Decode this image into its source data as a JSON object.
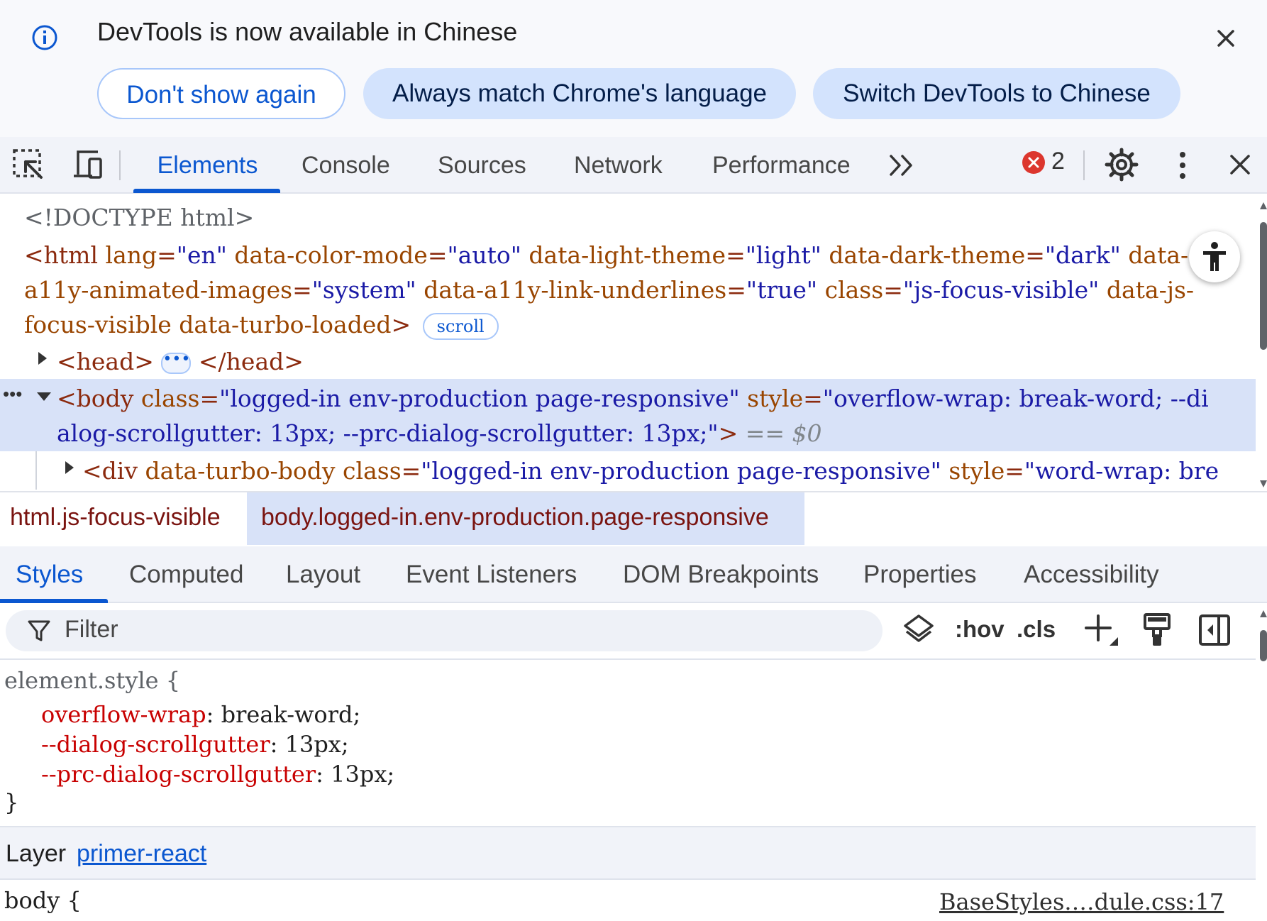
{
  "infobar": {
    "message": "DevTools is now available in Chinese",
    "buttons": [
      "Don't show again",
      "Always match Chrome's language",
      "Switch DevTools to Chinese"
    ]
  },
  "toolbar": {
    "tabs": [
      "Elements",
      "Console",
      "Sources",
      "Network",
      "Performance"
    ],
    "active_tab": "Elements",
    "error_count": "2"
  },
  "tree": {
    "doctype": "<!DOCTYPE html>",
    "html_line1": {
      "open": "<html ",
      "a1": "lang",
      "v1": "\"en\"",
      "a2": "data-color-mode",
      "v2": "\"auto\"",
      "a3": "data-light-theme",
      "v3": "\"light\"",
      "a4": "data-dark-theme",
      "v4": "\"dark\"",
      "a5": "data-"
    },
    "html_line2": {
      "a1": "a11y-animated-images",
      "v1": "\"system\"",
      "a2": "data-a11y-link-underlines",
      "v2": "\"true\"",
      "a3": "class",
      "v3": "\"js-focus-visible\"",
      "a4": "data-js-"
    },
    "html_line3": {
      "a1": "focus-visible data-turbo-loaded",
      "close": ">",
      "badge": "scroll"
    },
    "head": {
      "open": "<head>",
      "close": "</head>"
    },
    "body_line1": {
      "open": "<body ",
      "a1": "class",
      "v1": "\"logged-in env-production page-responsive\"",
      "a2": "style",
      "v2": "\"overflow-wrap: break-word; --di"
    },
    "body_line2": {
      "v": "alog-scrollgutter: 13px; --prc-dialog-scrollgutter: 13px;\"",
      "close": ">",
      "marker": "== $0"
    },
    "div_line": {
      "open": "<div ",
      "a1": "data-turbo-body",
      "a2": "class",
      "v2": "\"logged-in env-production page-responsive\"",
      "a3": "style",
      "v3": "\"word-wrap: bre"
    }
  },
  "breadcrumbs": [
    "html.js-focus-visible",
    "body.logged-in.env-production.page-responsive"
  ],
  "subtabs": [
    "Styles",
    "Computed",
    "Layout",
    "Event Listeners",
    "DOM Breakpoints",
    "Properties",
    "Accessibility"
  ],
  "filter": {
    "placeholder": "Filter",
    "hov": ":hov",
    "cls": ".cls"
  },
  "styles": {
    "selector": "element.style {",
    "rules": [
      {
        "prop": "overflow-wrap",
        "value": "break-word;"
      },
      {
        "prop": "--dialog-scrollgutter",
        "value": "13px;"
      },
      {
        "prop": "--prc-dialog-scrollgutter",
        "value": "13px;"
      }
    ],
    "close": "}",
    "layer_label": "Layer",
    "layer_name": "primer-react",
    "next_selector": "body {",
    "source": "BaseStyles.…dule.css:17"
  },
  "colors": {
    "accent": "#0b57d0",
    "tag": "#881280",
    "attr": "#994500",
    "value": "#1a1aa6",
    "property": "#c80000",
    "selection": "#d8e2f8",
    "error": "#dc362e"
  }
}
